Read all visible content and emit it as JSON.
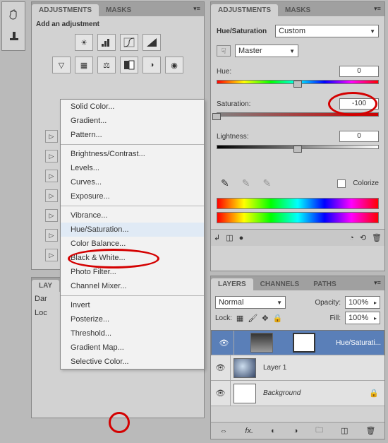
{
  "toolcol": {
    "t1": "hand",
    "t2": "clone"
  },
  "adj_left": {
    "tab1": "ADJUSTMENTS",
    "tab2": "MASKS",
    "heading": "Add an adjustment"
  },
  "flyout": {
    "items": [
      "Solid Color...",
      "Gradient...",
      "Pattern...",
      "",
      "Brightness/Contrast...",
      "Levels...",
      "Curves...",
      "Exposure...",
      "",
      "Vibrance...",
      "Hue/Saturation...",
      "Color Balance...",
      "Black & White...",
      "Photo Filter...",
      "Channel Mixer...",
      "",
      "Invert",
      "Posterize...",
      "Threshold...",
      "Gradient Map...",
      "Selective Color..."
    ],
    "highlight": "Hue/Saturation..."
  },
  "layers_left": {
    "tab": "LAY",
    "blend": "Dar",
    "lock": "Loc"
  },
  "adj_right": {
    "tab1": "ADJUSTMENTS",
    "tab2": "MASKS",
    "title": "Hue/Saturation",
    "preset": "Custom",
    "channel": "Master",
    "hue_lbl": "Hue:",
    "hue_val": "0",
    "sat_lbl": "Saturation:",
    "sat_val": "-100",
    "light_lbl": "Lightness:",
    "light_val": "0",
    "colorize": "Colorize"
  },
  "layers_right": {
    "t1": "LAYERS",
    "t2": "CHANNELS",
    "t3": "PATHS",
    "blend": "Normal",
    "opacity_lbl": "Opacity:",
    "opacity_val": "100%",
    "lock_lbl": "Lock:",
    "fill_lbl": "Fill:",
    "fill_val": "100%",
    "l1": "Hue/Saturati...",
    "l2": "Layer 1",
    "l3": "Background"
  }
}
